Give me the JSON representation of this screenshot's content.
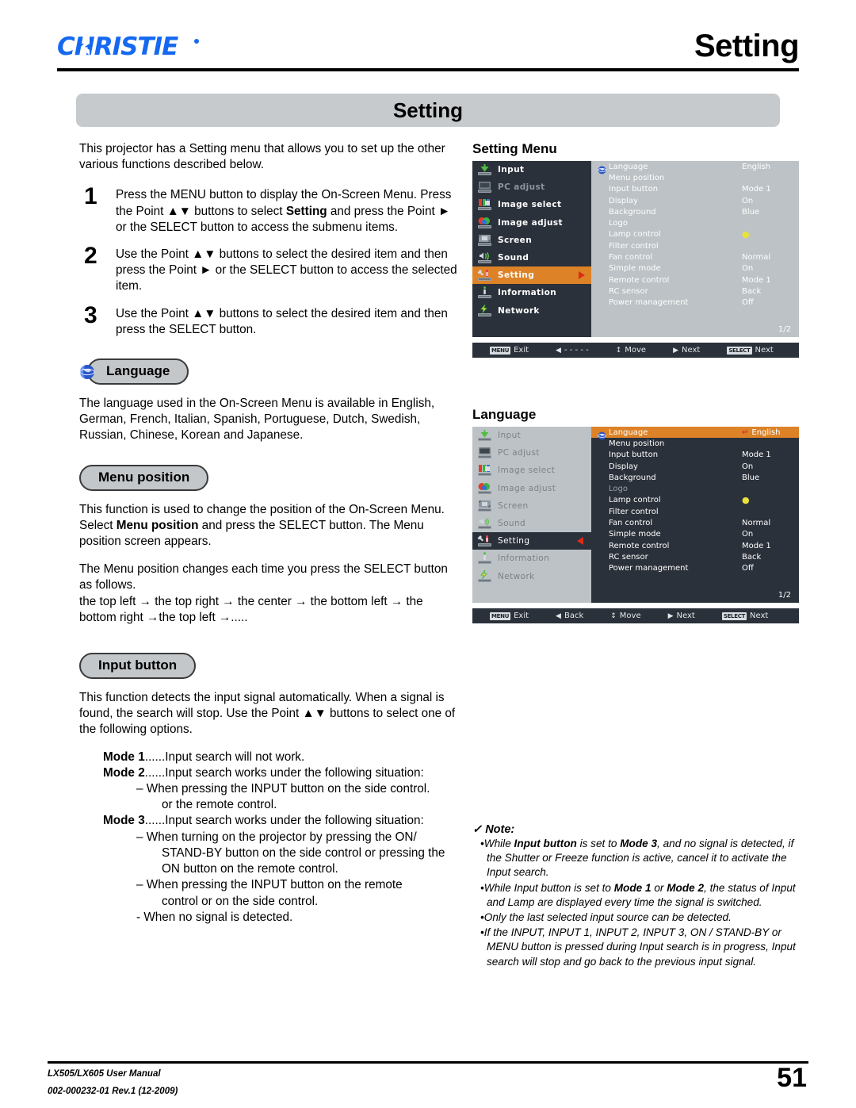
{
  "header": {
    "brand": "CHRISTIE",
    "title": "Setting"
  },
  "band": {
    "title": "Setting"
  },
  "intro": "This projector has a Setting menu that allows you to set up the other various functions described below.",
  "steps": [
    {
      "num": "1",
      "text_a": "Press the MENU button to display the On-Screen Menu. Press the Point ▲▼ buttons to select ",
      "bold": "Setting",
      "text_b": " and press the Point ► or the SELECT button to access the submenu items."
    },
    {
      "num": "2",
      "text_a": "Use the Point ▲▼ buttons to select the desired item and then press the Point ► or the SELECT button to access the selected item.",
      "bold": "",
      "text_b": ""
    },
    {
      "num": "3",
      "text_a": "Use the Point ▲▼ buttons to select the desired item and then press the SELECT button.",
      "bold": "",
      "text_b": ""
    }
  ],
  "sections": {
    "language": {
      "pill": "Language",
      "body": "The language used in the On-Screen Menu is available in English, German, French, Italian, Spanish, Portuguese, Dutch, Swedish, Russian, Chinese, Korean and Japanese."
    },
    "menu_position": {
      "pill": "Menu position",
      "body_a": "This function is used to change the position of the On-Screen Menu. Select ",
      "body_bold": "Menu position",
      "body_b": " and press the SELECT button. The Menu position screen appears.",
      "body2": "The Menu position changes each time you press the SELECT button as follows.",
      "body3": "the top left  → the top right  → the center → the bottom left → the bottom right  →the top left  →....."
    },
    "input_button": {
      "pill": "Input button",
      "body": "This function detects the input signal automatically. When a signal is found, the search will stop. Use the Point ▲▼ buttons to select one of the following options.",
      "modes": [
        {
          "name": "Mode 1",
          "dots": "......",
          "desc": "Input search will not work.",
          "subs": []
        },
        {
          "name": "Mode 2",
          "dots": "......",
          "desc": "Input search works under the following situation:",
          "subs": [
            "– When pressing the INPUT button on the side control.",
            "or the remote control."
          ]
        },
        {
          "name": "Mode 3",
          "dots": "......",
          "desc": "Input search works under the following situation:",
          "subs": [
            "– When turning on the projector by pressing the ON/",
            "STAND-BY button on the side control or pressing the",
            "ON button on the remote control.",
            "– When pressing the INPUT button on the remote",
            "control or on the side control.",
            "- When no signal is detected."
          ]
        }
      ]
    }
  },
  "osd_setting_menu": {
    "title": "Setting Menu",
    "sidebar": [
      {
        "label": "Input",
        "icon": "input-icon",
        "state": "normal"
      },
      {
        "label": "PC adjust",
        "icon": "pc-adjust-icon",
        "state": "dim"
      },
      {
        "label": "Image select",
        "icon": "image-select-icon",
        "state": "normal"
      },
      {
        "label": "Image adjust",
        "icon": "image-adjust-icon",
        "state": "normal"
      },
      {
        "label": "Screen",
        "icon": "screen-icon",
        "state": "normal"
      },
      {
        "label": "Sound",
        "icon": "sound-icon",
        "state": "normal"
      },
      {
        "label": "Setting",
        "icon": "setting-icon",
        "state": "selected"
      },
      {
        "label": "Information",
        "icon": "information-icon",
        "state": "normal"
      },
      {
        "label": "Network",
        "icon": "network-icon",
        "state": "normal"
      }
    ],
    "rows": [
      {
        "label": "Language",
        "value": "English",
        "icon": "globe-icon"
      },
      {
        "label": "Menu position",
        "value": "",
        "icon": ""
      },
      {
        "label": "Input button",
        "value": "Mode 1",
        "icon": ""
      },
      {
        "label": "Display",
        "value": "On",
        "icon": ""
      },
      {
        "label": "Background",
        "value": "Blue",
        "icon": ""
      },
      {
        "label": "Logo",
        "value": "",
        "icon": ""
      },
      {
        "label": "Lamp control",
        "value": "",
        "icon": "lamp-icon"
      },
      {
        "label": "Filter control",
        "value": "",
        "icon": ""
      },
      {
        "label": "Fan control",
        "value": "Normal",
        "icon": ""
      },
      {
        "label": "Simple mode",
        "value": "On",
        "icon": ""
      },
      {
        "label": "Remote control",
        "value": "Mode 1",
        "icon": ""
      },
      {
        "label": "RC sensor",
        "value": "Back",
        "icon": ""
      },
      {
        "label": "Power management",
        "value": "Off",
        "icon": ""
      }
    ],
    "page_indicator": "1/2",
    "bottom_bar": [
      {
        "key": "MENU",
        "arrow": "",
        "label": "Exit"
      },
      {
        "key": "",
        "arrow": "◀",
        "label": "- - - - -"
      },
      {
        "key": "",
        "arrow": "↕",
        "label": "Move"
      },
      {
        "key": "",
        "arrow": "▶",
        "label": "Next"
      },
      {
        "key": "SELECT",
        "arrow": "",
        "label": "Next"
      }
    ]
  },
  "osd_language": {
    "title": "Language",
    "sidebar": [
      {
        "label": "Input",
        "icon": "input-icon",
        "state": "dim"
      },
      {
        "label": "PC adjust",
        "icon": "pc-adjust-icon",
        "state": "dim"
      },
      {
        "label": "Image select",
        "icon": "image-select-icon",
        "state": "dim"
      },
      {
        "label": "Image adjust",
        "icon": "image-adjust-icon",
        "state": "dim"
      },
      {
        "label": "Screen",
        "icon": "screen-icon",
        "state": "dim"
      },
      {
        "label": "Sound",
        "icon": "sound-icon",
        "state": "dim"
      },
      {
        "label": "Setting",
        "icon": "setting-icon",
        "state": "selected"
      },
      {
        "label": "Information",
        "icon": "information-icon",
        "state": "dim"
      },
      {
        "label": "Network",
        "icon": "network-icon",
        "state": "dim"
      }
    ],
    "rows": [
      {
        "label": "Language",
        "value": "English",
        "icon": "globe-icon",
        "state": "highlight"
      },
      {
        "label": "Menu position",
        "value": "",
        "icon": "",
        "state": "normal"
      },
      {
        "label": "Input button",
        "value": "Mode 1",
        "icon": "",
        "state": "normal"
      },
      {
        "label": "Display",
        "value": "On",
        "icon": "",
        "state": "normal"
      },
      {
        "label": "Background",
        "value": "Blue",
        "icon": "",
        "state": "normal"
      },
      {
        "label": "Logo",
        "value": "",
        "icon": "",
        "state": "dim"
      },
      {
        "label": "Lamp control",
        "value": "",
        "icon": "lamp-icon",
        "state": "normal"
      },
      {
        "label": "Filter control",
        "value": "",
        "icon": "",
        "state": "normal"
      },
      {
        "label": "Fan control",
        "value": "Normal",
        "icon": "",
        "state": "normal"
      },
      {
        "label": "Simple mode",
        "value": "On",
        "icon": "",
        "state": "normal"
      },
      {
        "label": "Remote control",
        "value": "Mode 1",
        "icon": "",
        "state": "normal"
      },
      {
        "label": "RC sensor",
        "value": "Back",
        "icon": "",
        "state": "normal"
      },
      {
        "label": "Power management",
        "value": "Off",
        "icon": "",
        "state": "normal"
      }
    ],
    "page_indicator": "1/2",
    "bottom_bar": [
      {
        "key": "MENU",
        "arrow": "",
        "label": "Exit"
      },
      {
        "key": "",
        "arrow": "◀",
        "label": "Back"
      },
      {
        "key": "",
        "arrow": "↕",
        "label": "Move"
      },
      {
        "key": "",
        "arrow": "▶",
        "label": "Next"
      },
      {
        "key": "SELECT",
        "arrow": "",
        "label": "Next"
      }
    ]
  },
  "note": {
    "heading": "Note:",
    "items": [
      {
        "pre": "While ",
        "b1": "Input button",
        "mid": " is set to ",
        "b2": "Mode 3",
        "post": ", and no signal is detected, if the Shutter or Freeze function is active, cancel it to activate the Input search."
      },
      {
        "pre": "While Input button is set to ",
        "b1": "Mode 1",
        "mid": " or ",
        "b2": "Mode 2",
        "post": ", the status of Input and Lamp are displayed every time the signal is switched."
      },
      {
        "pre": "Only the last selected input source can be detected.",
        "b1": "",
        "mid": "",
        "b2": "",
        "post": ""
      },
      {
        "pre": "If the INPUT, INPUT 1, INPUT 2, INPUT 3, ON / STAND-BY or MENU button is pressed during Input search is in progress, Input search will stop and go back to the previous input signal.",
        "b1": "",
        "mid": "",
        "b2": "",
        "post": ""
      }
    ]
  },
  "footer": {
    "line1": "LX505/LX605 User Manual",
    "line2": "002-000232-01 Rev.1 (12-2009)",
    "page": "51"
  },
  "colors": {
    "brand_blue": "#1569f0",
    "band_gray": "#c6cacd",
    "osd_dark": "#2b313a",
    "osd_light": "#bcc2c6",
    "osd_orange": "#dd8227",
    "osd_red": "#e02b18",
    "osd_yellow": "#e9e23a"
  }
}
